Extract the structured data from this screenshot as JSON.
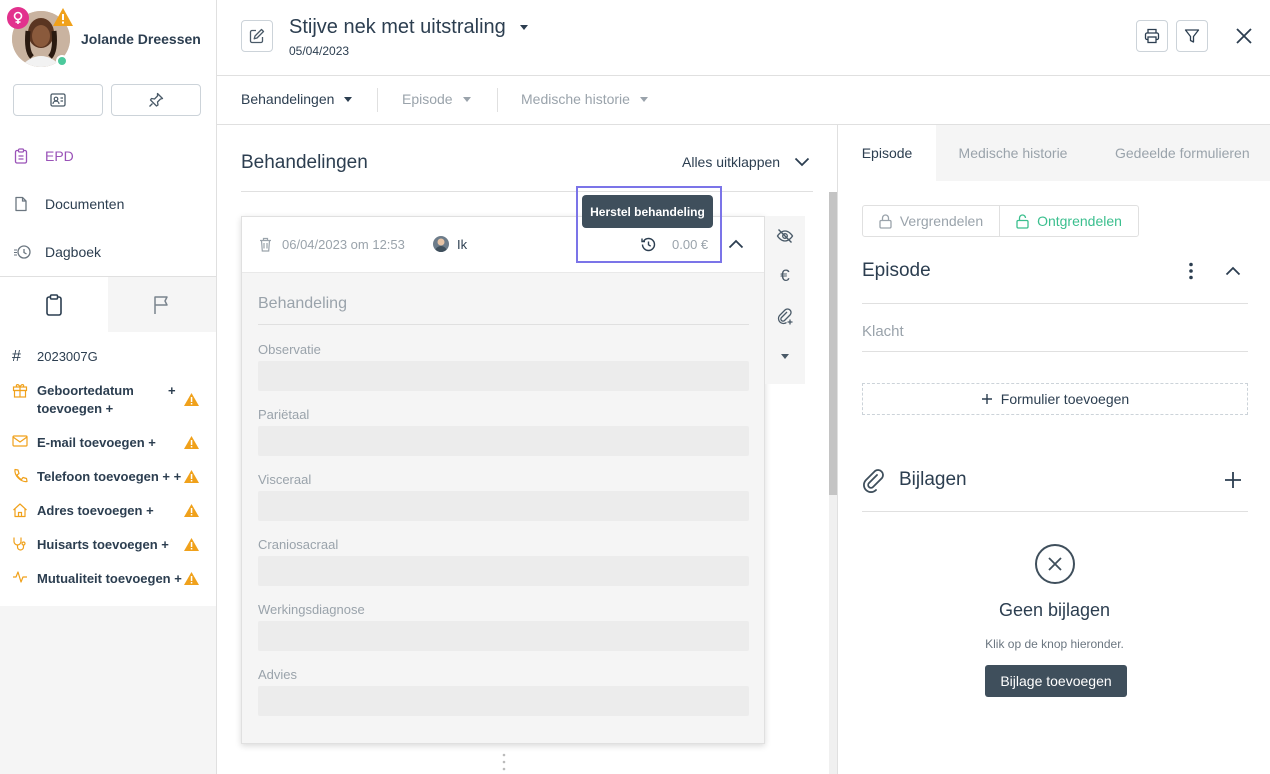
{
  "patient": {
    "name": "Jolande Dreessen"
  },
  "sidebar": {
    "nav": [
      {
        "label": "EPD",
        "icon": "clipboard-icon",
        "active": true
      },
      {
        "label": "Documenten",
        "icon": "document-icon"
      },
      {
        "label": "Dagboek",
        "icon": "history-icon"
      }
    ],
    "info": {
      "id": "2023007G",
      "rows": [
        {
          "label": "Geboortedatum\ntoevoegen +",
          "plus": "+",
          "icon": "gift-icon"
        },
        {
          "label": "E-mail toevoegen +",
          "icon": "mail-icon"
        },
        {
          "label": "Telefoon toevoegen + +",
          "icon": "phone-icon"
        },
        {
          "label": "Adres toevoegen +",
          "icon": "home-icon"
        },
        {
          "label": "Huisarts toevoegen +",
          "icon": "stethoscope-icon"
        },
        {
          "label": "Mutualiteit toevoegen +",
          "icon": "pulse-icon"
        }
      ]
    }
  },
  "header": {
    "title": "Stijve nek met uitstraling",
    "date": "05/04/2023"
  },
  "subnav": {
    "items": [
      "Behandelingen",
      "Episode",
      "Medische historie"
    ]
  },
  "main": {
    "title": "Behandelingen",
    "expand_all": "Alles uitklappen",
    "treatment": {
      "datetime": "06/04/2023 om 12:53",
      "user": "Ik",
      "price": "0.00 €",
      "tooltip": "Herstel behandeling",
      "section": "Behandeling",
      "fields": [
        "Observatie",
        "Pariëtaal",
        "Visceraal",
        "Craniosacraal",
        "Werkingsdiagnose",
        "Advies"
      ]
    }
  },
  "right": {
    "tabs": [
      "Episode",
      "Medische historie",
      "Gedeelde formulieren"
    ],
    "lock": "Vergrendelen",
    "unlock": "Ontgrendelen",
    "episode_title": "Episode",
    "complaint_label": "Klacht",
    "add_form": "Formulier toevoegen",
    "attachments_title": "Bijlagen",
    "empty_title": "Geen bijlagen",
    "empty_sub": "Klik op de knop hieronder.",
    "add_attachment": "Bijlage toevoegen"
  },
  "colors": {
    "accent": "#9a53b8",
    "success": "#3bbf8e",
    "warning": "#f0a11b",
    "dark": "#3f4f5c",
    "highlight": "#7b74e8"
  }
}
